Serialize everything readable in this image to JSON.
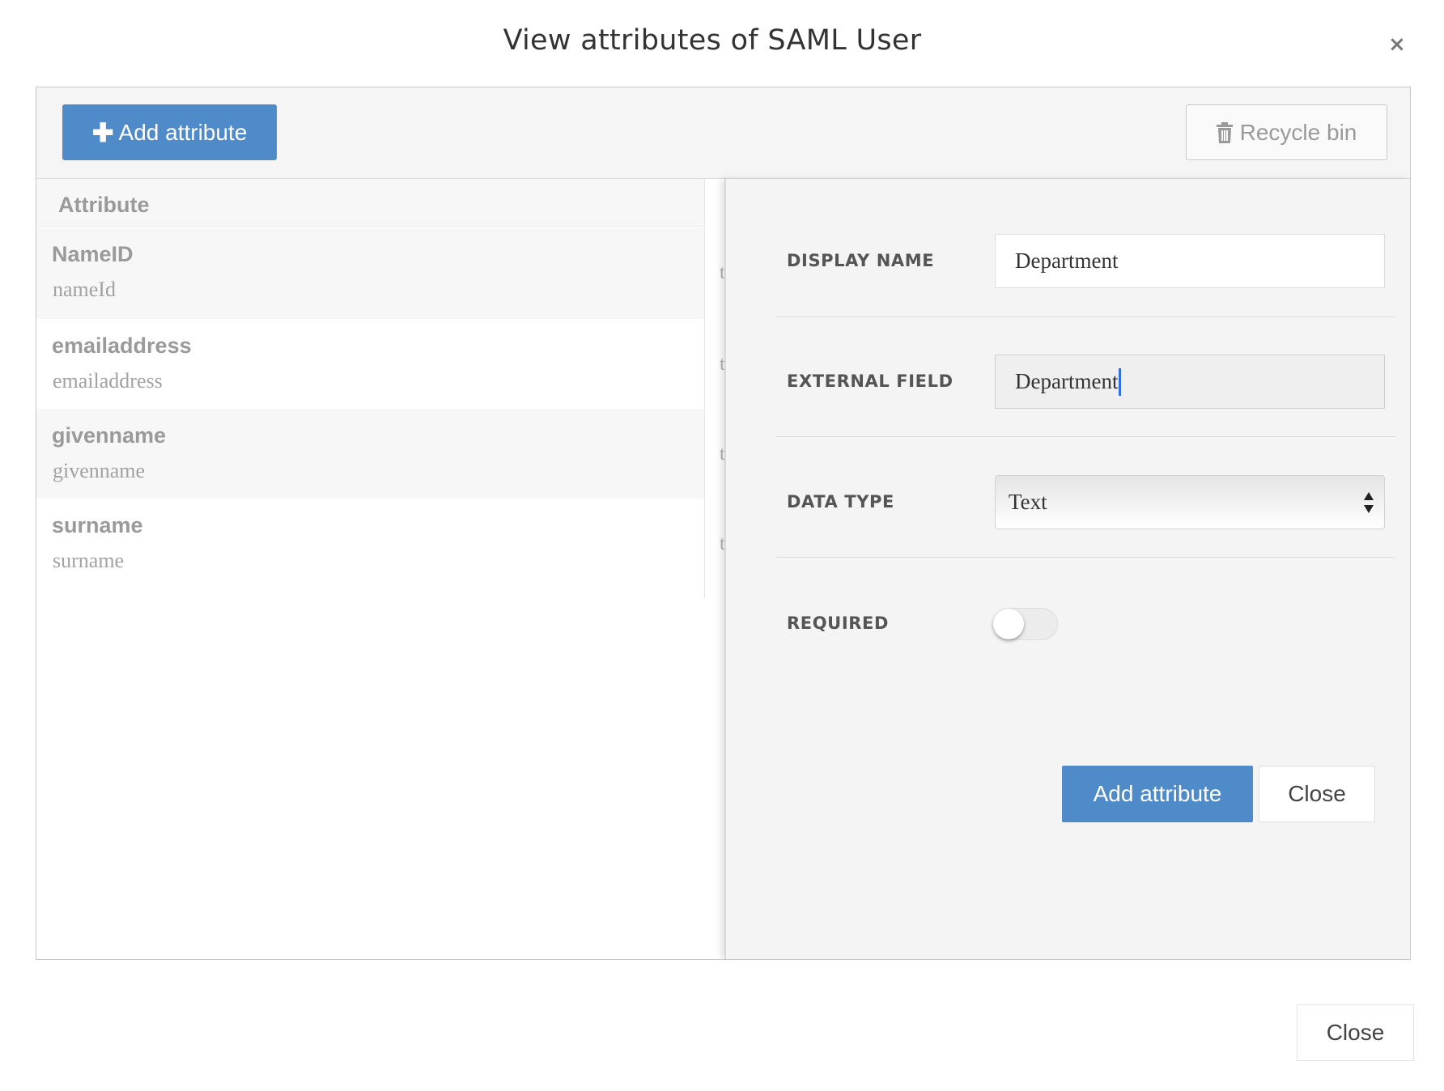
{
  "modal": {
    "title": "View attributes of SAML User",
    "close_symbol": "×"
  },
  "toolbar": {
    "add_label": "Add attribute",
    "add_icon": "plus-icon",
    "recycle_label": "Recycle bin",
    "recycle_icon": "trash-icon"
  },
  "list": {
    "header": "Attribute",
    "rows": [
      {
        "name": "NameID",
        "key": "nameId",
        "truncated": "t"
      },
      {
        "name": "emailaddress",
        "key": "emailaddress",
        "truncated": "t"
      },
      {
        "name": "givenname",
        "key": "givenname",
        "truncated": "t"
      },
      {
        "name": "surname",
        "key": "surname",
        "truncated": "t"
      }
    ]
  },
  "form": {
    "display_name": {
      "label": "DISPLAY NAME",
      "value": "Department"
    },
    "external_field": {
      "label": "EXTERNAL FIELD",
      "value": "Department"
    },
    "data_type": {
      "label": "DATA TYPE",
      "value": "Text"
    },
    "required": {
      "label": "REQUIRED",
      "on": false
    },
    "submit_label": "Add attribute",
    "close_label": "Close"
  },
  "footer": {
    "close_label": "Close"
  },
  "colors": {
    "primary": "#4f8ac9",
    "caret": "#2f6fe0"
  }
}
